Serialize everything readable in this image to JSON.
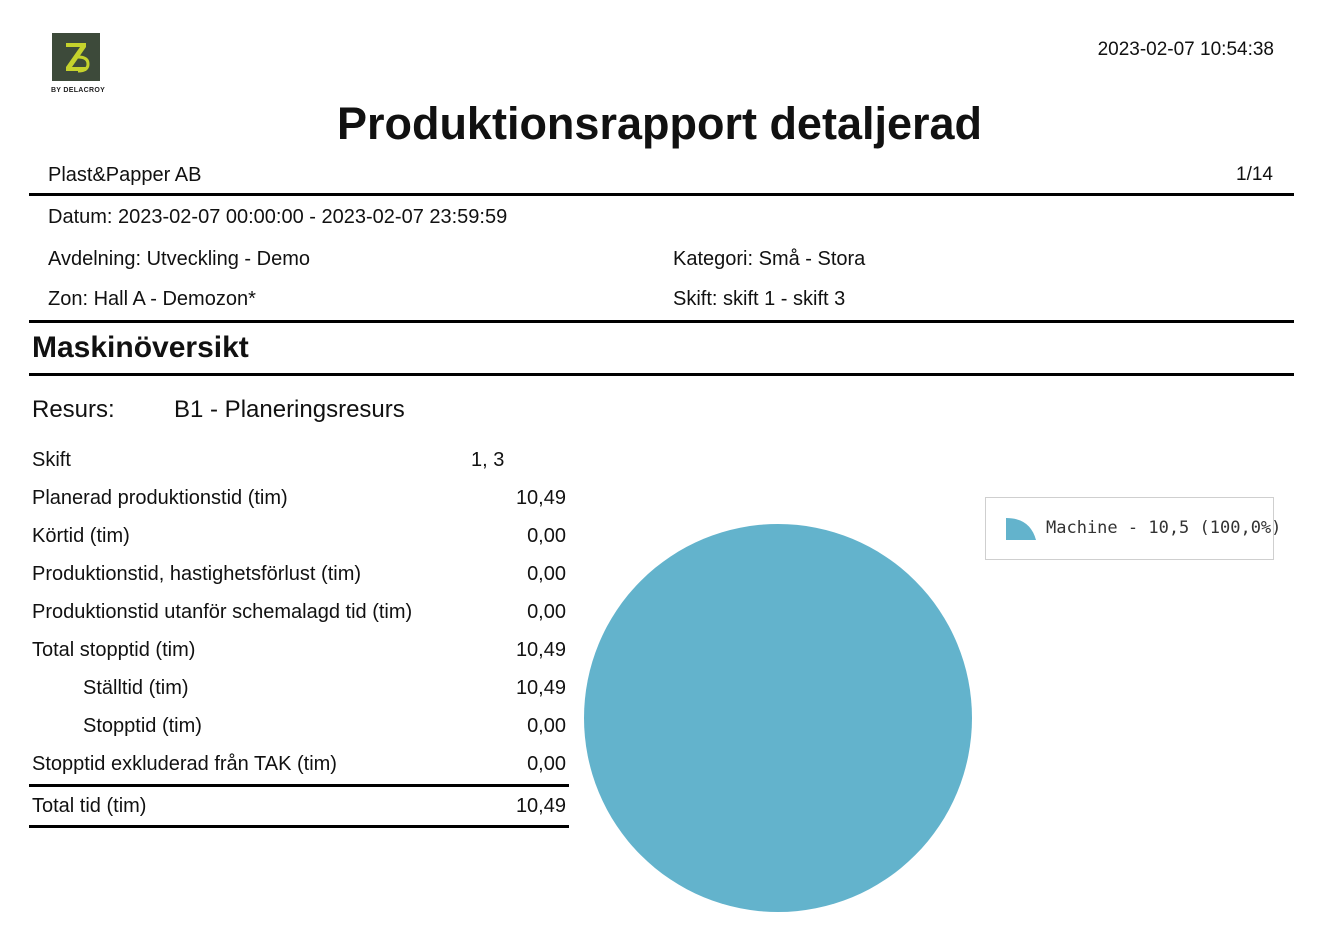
{
  "header": {
    "logo_caption": "BY DELACROY",
    "timestamp": "2023-02-07 10:54:38",
    "title": "Produktionsrapport detaljerad",
    "company": "Plast&Papper AB",
    "page": "1/14"
  },
  "filters": {
    "datum": "Datum: 2023-02-07 00:00:00 - 2023-02-07 23:59:59",
    "avdelning": "Avdelning: Utveckling - Demo",
    "kategori": "Kategori: Små - Stora",
    "zon": "Zon: Hall A - Demozon*",
    "skift": "Skift: skift 1 - skift 3"
  },
  "section": {
    "title": "Maskinöversikt",
    "resurs_label": "Resurs:",
    "resurs_value": "B1 - Planeringsresurs"
  },
  "stats": [
    {
      "label": "Skift",
      "value": "1, 3"
    },
    {
      "label": "Planerad produktionstid (tim)",
      "value": "10,49"
    },
    {
      "label": "Körtid (tim)",
      "value": "0,00"
    },
    {
      "label": "Produktionstid, hastighetsförlust (tim)",
      "value": "0,00"
    },
    {
      "label": "Produktionstid utanför schemalagd tid (tim)",
      "value": "0,00"
    },
    {
      "label": "Total stopptid (tim)",
      "value": "10,49"
    },
    {
      "label": "Ställtid (tim)",
      "value": "10,49"
    },
    {
      "label": "Stopptid (tim)",
      "value": "0,00"
    },
    {
      "label": "Stopptid exkluderad från TAK (tim)",
      "value": "0,00"
    },
    {
      "label": "Total tid (tim)",
      "value": "10,49"
    }
  ],
  "colors": {
    "pie_fill": "#63b3cc",
    "logo_bg": "#3d4a3a",
    "logo_mark": "#c5d22c"
  },
  "chart_data": {
    "type": "pie",
    "categories": [
      "Machine"
    ],
    "values": [
      10.5
    ],
    "percentages": [
      100.0
    ],
    "legend": [
      "Machine - 10,5 (100,0%)"
    ],
    "legend_position": "top-right"
  }
}
